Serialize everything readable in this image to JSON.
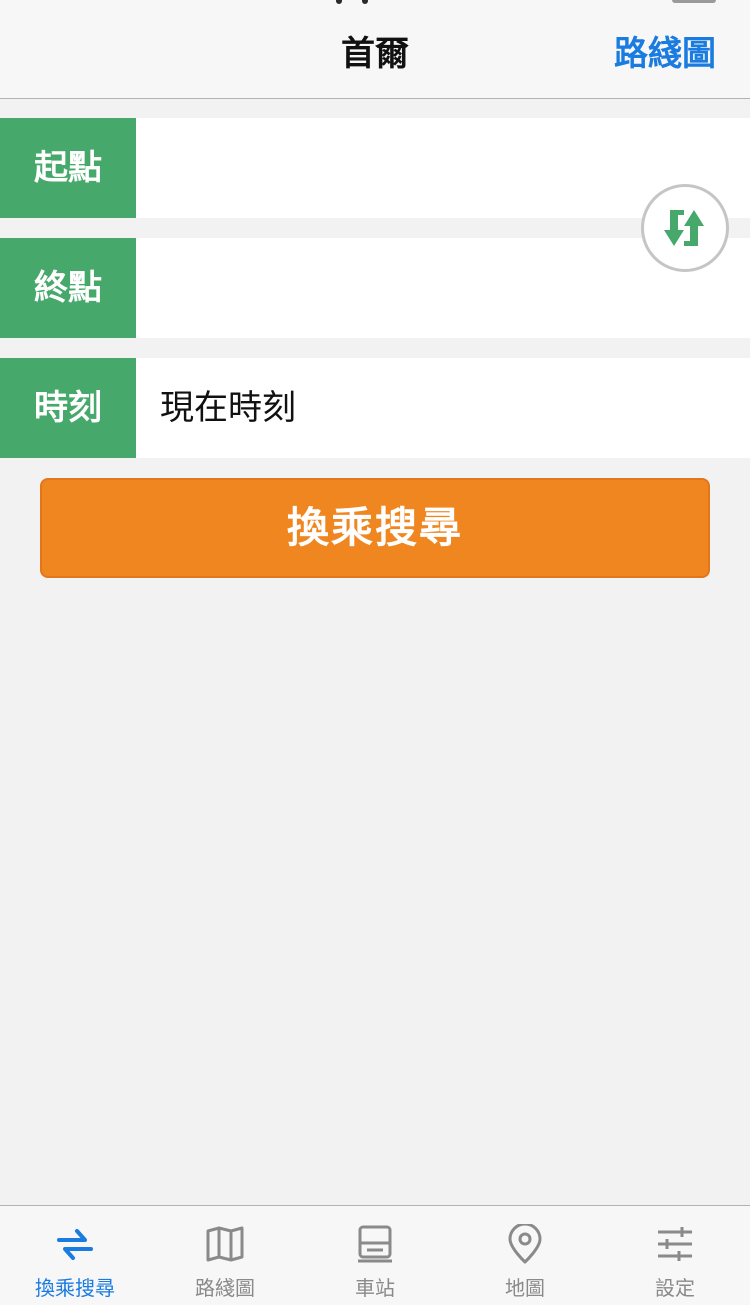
{
  "navbar": {
    "title": "首爾",
    "route_map_link": "路綫圖"
  },
  "form": {
    "origin_label": "起點",
    "origin_value": "",
    "destination_label": "終點",
    "destination_value": "",
    "time_label": "時刻",
    "time_value": "現在時刻",
    "swap_icon": "swap-arrows-icon",
    "search_button": "換乘搜尋"
  },
  "tabbar": {
    "items": [
      {
        "label": "換乘搜尋",
        "icon": "transfer-icon",
        "active": true
      },
      {
        "label": "路綫圖",
        "icon": "map-book-icon",
        "active": false
      },
      {
        "label": "車站",
        "icon": "station-icon",
        "active": false
      },
      {
        "label": "地圖",
        "icon": "location-pin-icon",
        "active": false
      },
      {
        "label": "設定",
        "icon": "sliders-icon",
        "active": false
      }
    ]
  },
  "colors": {
    "accent_blue": "#1a7be0",
    "label_green": "#46a86a",
    "search_orange": "#f08620",
    "background": "#f2f2f2",
    "inactive_gray": "#8a8a8a"
  }
}
